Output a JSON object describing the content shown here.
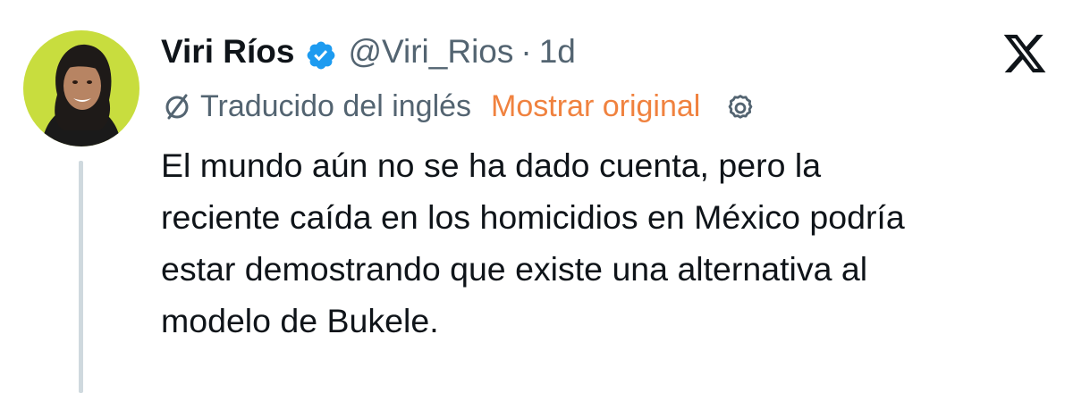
{
  "author": {
    "name": "Viri Ríos",
    "handle": "@Viri_Rios",
    "separator": "·",
    "time": "1d",
    "verified_icon": "verified-badge-icon",
    "verified_color": "#1d9bf0"
  },
  "platform_icon": "x-logo-icon",
  "translation": {
    "icon": "translate-globe-icon",
    "label": "Traducido del inglés",
    "action": "Mostrar original",
    "action_color": "#f0823f",
    "settings_icon": "gear-icon"
  },
  "tweet": {
    "lines": [
      "El mundo aún no se ha dado cuenta, pero la",
      "reciente caída en los homicidios en México podría",
      "estar demostrando que existe una alternativa al",
      "modelo de Bukele."
    ]
  },
  "colors": {
    "text_primary": "#0f1419",
    "text_secondary": "#536471",
    "avatar_background": "#c5dc3a",
    "thread_line": "#cfd9de"
  }
}
